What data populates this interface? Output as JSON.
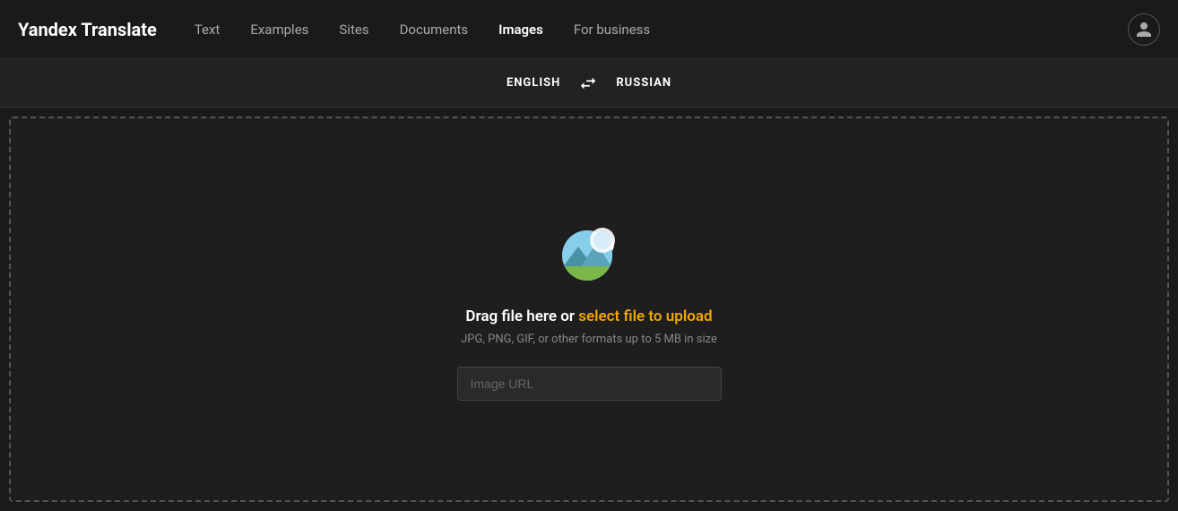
{
  "header": {
    "logo": "Yandex Translate",
    "nav": [
      {
        "label": "Text",
        "active": false
      },
      {
        "label": "Examples",
        "active": false
      },
      {
        "label": "Sites",
        "active": false
      },
      {
        "label": "Documents",
        "active": false
      },
      {
        "label": "Images",
        "active": true
      },
      {
        "label": "For business",
        "active": false
      }
    ],
    "user_icon": "👤"
  },
  "lang_bar": {
    "source_lang": "ENGLISH",
    "target_lang": "RUSSIAN",
    "swap_icon": "⇄"
  },
  "drop_zone": {
    "drop_text_static": "Drag file here or ",
    "drop_text_link": "select file to upload",
    "subtitle": "JPG, PNG, GIF, or other formats up to 5 MB in size",
    "url_placeholder": "Image URL"
  }
}
